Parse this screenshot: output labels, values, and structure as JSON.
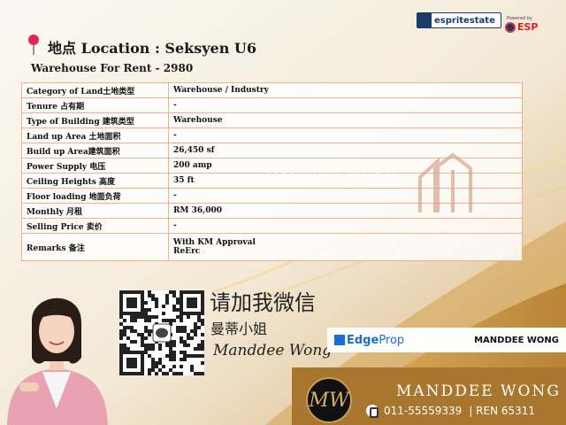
{
  "header": {
    "location_title": "地点 Location : Seksyen U6",
    "listing": "Warehouse For Rent - 2980"
  },
  "brands": {
    "espritestate": "espritestate",
    "powered_by": "Powered by",
    "esp": "ESP"
  },
  "table": {
    "rows": [
      {
        "label": "Category of Land土地类型",
        "value": "Warehouse / Industry"
      },
      {
        "label": "Tenure 占有期",
        "value": "-"
      },
      {
        "label": "Type of Building 建筑类型",
        "value": "Warehouse"
      },
      {
        "label": "Land up Area 土地面积",
        "value": "-"
      },
      {
        "label": "Build up Area建筑面积",
        "value": "26,450 sf"
      },
      {
        "label": "Power Supply 电压",
        "value": "200 amp"
      },
      {
        "label": "Ceiling Heights 高度",
        "value": "35 ft"
      },
      {
        "label": "Floor loading 地面负荷",
        "value": "-"
      },
      {
        "label": "Monthly 月租",
        "value": "RM 36,000"
      },
      {
        "label": "Selling Price 卖价",
        "value": "-"
      },
      {
        "label": "Remarks 备注",
        "value": "With KM Approval",
        "value2": "ReErc"
      }
    ]
  },
  "watermark": {
    "line1": "MANDDEE WONG",
    "line2": "INDUSTRIAL PROPERTY",
    "line3": "SPECIALIST"
  },
  "contact": {
    "wechat_cta": "请加我微信",
    "chinese_name": "曼蒂小姐",
    "signature": "Manddee Wong"
  },
  "edgeprop": {
    "logo_edge": "Edge",
    "logo_prop": "Prop",
    "agent_name": "MANDDEE WONG"
  },
  "footer": {
    "monogram": "MW",
    "name": "MANDDEE WONG",
    "phone": "011-55559339",
    "ren": "| REN 65311"
  },
  "colors": {
    "accent_gold": "#c9a052",
    "table_border": "#f0b08c",
    "edgeprop_blue": "#1b6fd1",
    "pin_red": "#e0284f"
  }
}
